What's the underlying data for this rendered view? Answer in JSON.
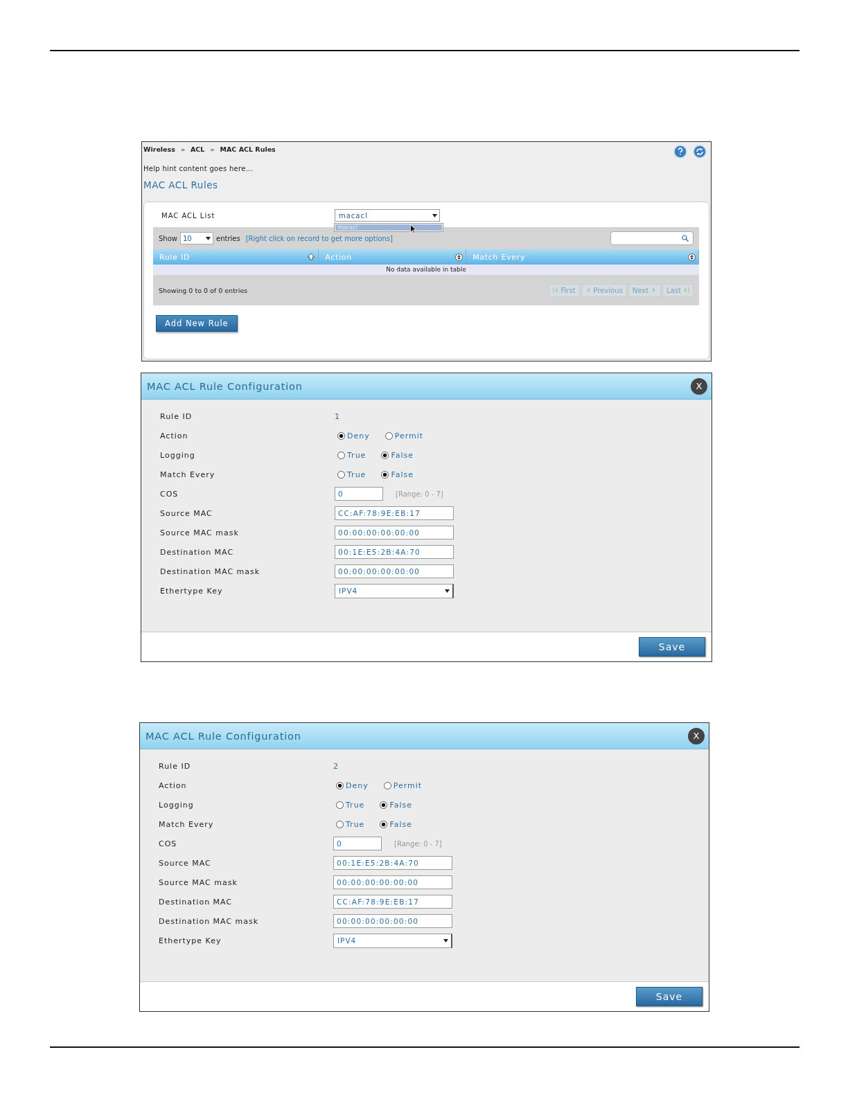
{
  "rules_panel": {
    "breadcrumb": [
      {
        "label": "Wireless"
      },
      {
        "label": "ACL"
      },
      {
        "label": "MAC ACL Rules"
      }
    ],
    "separator": "»",
    "help_text": "Help hint content goes here...",
    "heading": "MAC ACL Rules",
    "acl_list": {
      "label": "MAC ACL List",
      "value": "macacl",
      "options": [
        {
          "label": "macacl",
          "selected": true
        }
      ]
    },
    "table": {
      "show_label": "Show",
      "page_length": "10",
      "entries_label": "entries",
      "hint": "[Right click on record to get more options]",
      "columns": [
        {
          "label": "Rule ID",
          "sorted": true
        },
        {
          "label": "Action",
          "sorted": false
        },
        {
          "label": "Match Every",
          "sorted": false
        }
      ],
      "empty": "No data available in table",
      "info": "Showing 0 to 0 of 0 entries",
      "pager": [
        {
          "label": "First",
          "kind": "first",
          "disabled": true
        },
        {
          "label": "Previous",
          "kind": "prev",
          "disabled": true
        },
        {
          "label": "Next",
          "kind": "next",
          "disabled": true
        },
        {
          "label": "Last",
          "kind": "last",
          "disabled": true
        }
      ]
    },
    "add_button": "Add New Rule"
  },
  "dialogs": [
    {
      "title": "MAC ACL Rule Configuration",
      "close": "X",
      "save": "Save",
      "fields": [
        {
          "kind": "text",
          "label": "Rule ID",
          "value": "1"
        },
        {
          "kind": "radio",
          "label": "Action",
          "options": [
            {
              "label": "Deny",
              "selected": true
            },
            {
              "label": "Permit",
              "selected": false
            }
          ]
        },
        {
          "kind": "radio",
          "label": "Logging",
          "options": [
            {
              "label": "True",
              "selected": false
            },
            {
              "label": "False",
              "selected": true
            }
          ]
        },
        {
          "kind": "radio",
          "label": "Match Every",
          "options": [
            {
              "label": "True",
              "selected": false
            },
            {
              "label": "False",
              "selected": true
            }
          ]
        },
        {
          "kind": "input",
          "label": "COS",
          "value": "0",
          "hint": "[Range: 0 - 7]"
        },
        {
          "kind": "input",
          "label": "Source MAC",
          "value": "CC:AF:78:9E:EB:17"
        },
        {
          "kind": "input",
          "label": "Source MAC mask",
          "value": "00:00:00:00:00:00"
        },
        {
          "kind": "input",
          "label": "Destination MAC",
          "value": "00:1E:E5:2B:4A:70"
        },
        {
          "kind": "input",
          "label": "Destination MAC mask",
          "value": "00:00:00:00:00:00"
        },
        {
          "kind": "select",
          "label": "Ethertype Key",
          "value": "IPV4"
        }
      ]
    },
    {
      "title": "MAC ACL Rule Configuration",
      "close": "X",
      "save": "Save",
      "fields": [
        {
          "kind": "text",
          "label": "Rule ID",
          "value": "2"
        },
        {
          "kind": "radio",
          "label": "Action",
          "options": [
            {
              "label": "Deny",
              "selected": true
            },
            {
              "label": "Permit",
              "selected": false
            }
          ]
        },
        {
          "kind": "radio",
          "label": "Logging",
          "options": [
            {
              "label": "True",
              "selected": false
            },
            {
              "label": "False",
              "selected": true
            }
          ]
        },
        {
          "kind": "radio",
          "label": "Match Every",
          "options": [
            {
              "label": "True",
              "selected": false
            },
            {
              "label": "False",
              "selected": true
            }
          ]
        },
        {
          "kind": "input",
          "label": "COS",
          "value": "0",
          "hint": "[Range: 0 - 7]"
        },
        {
          "kind": "input",
          "label": "Source MAC",
          "value": "00:1E:E5:2B:4A:70"
        },
        {
          "kind": "input",
          "label": "Source MAC mask",
          "value": "00:00:00:00:00:00"
        },
        {
          "kind": "input",
          "label": "Destination MAC",
          "value": "CC:AF:78:9E:EB:17"
        },
        {
          "kind": "input",
          "label": "Destination MAC mask",
          "value": "00:00:00:00:00:00"
        },
        {
          "kind": "select",
          "label": "Ethertype Key",
          "value": "IPV4"
        }
      ]
    }
  ]
}
